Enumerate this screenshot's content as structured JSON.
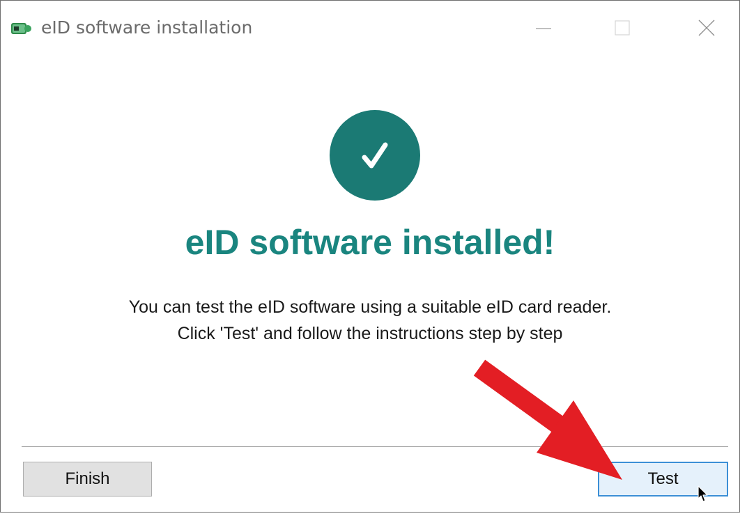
{
  "window": {
    "title": "eID software installation",
    "minimize_icon": "minimize-icon",
    "maximize_icon": "maximize-icon",
    "close_icon": "close-icon"
  },
  "content": {
    "status_icon": "checkmark-circle-icon",
    "headline": "eID software installed!",
    "description_line1": "You can test the eID software using a suitable eID card reader.",
    "description_line2": "Click 'Test' and follow the instructions step by step"
  },
  "footer": {
    "finish_label": "Finish",
    "test_label": "Test"
  },
  "colors": {
    "accent": "#1a857f",
    "annotation_arrow": "#e31e24",
    "focused_button_border": "#3c8fd6"
  }
}
